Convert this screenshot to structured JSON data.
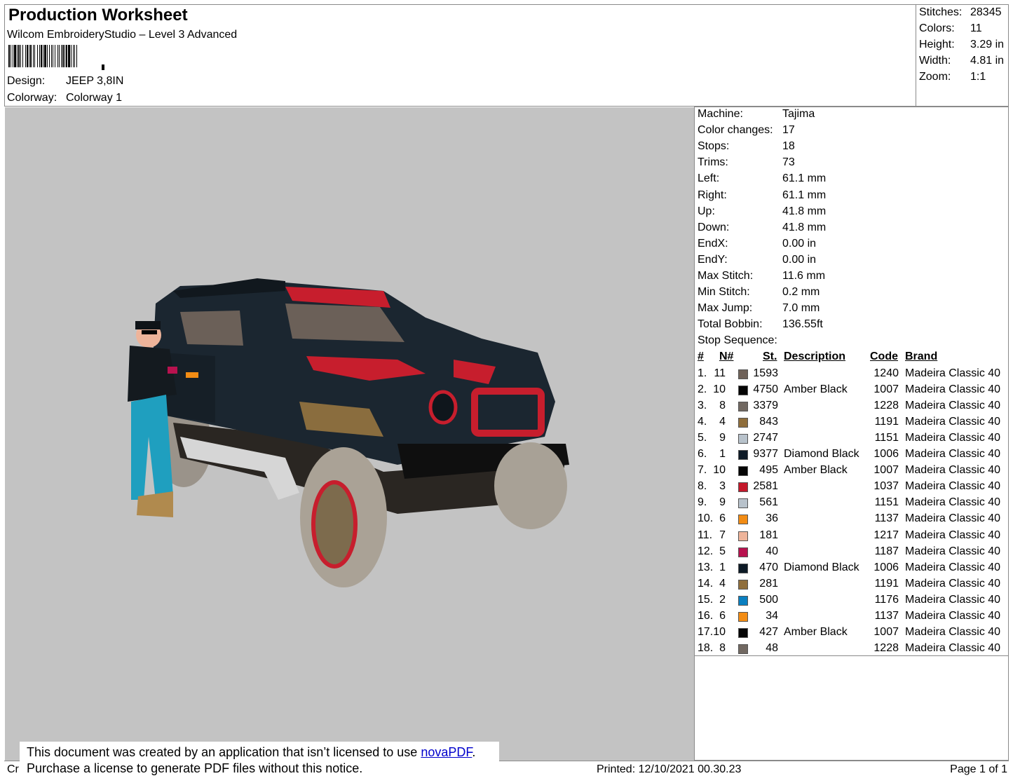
{
  "header": {
    "title": "Production Worksheet",
    "subtitle": "Wilcom EmbroideryStudio – Level 3 Advanced",
    "design_label": "Design:",
    "design_value": "JEEP 3,8IN",
    "colorway_label": "Colorway:",
    "colorway_value": "Colorway 1"
  },
  "summary": [
    {
      "label": "Stitches:",
      "value": "28345"
    },
    {
      "label": "Colors:",
      "value": "11"
    },
    {
      "label": "Height:",
      "value": "3.29 in"
    },
    {
      "label": "Width:",
      "value": "4.81 in"
    },
    {
      "label": "Zoom:",
      "value": "1:1"
    }
  ],
  "machine_info": [
    {
      "label": "Machine:",
      "value": "Tajima"
    },
    {
      "label": "Color changes:",
      "value": "17"
    },
    {
      "label": "Stops:",
      "value": "18"
    },
    {
      "label": "Trims:",
      "value": "73"
    },
    {
      "label": "Left:",
      "value": "61.1 mm"
    },
    {
      "label": "Right:",
      "value": "61.1 mm"
    },
    {
      "label": "Up:",
      "value": "41.8 mm"
    },
    {
      "label": "Down:",
      "value": "41.8 mm"
    },
    {
      "label": "EndX:",
      "value": "0.00 in"
    },
    {
      "label": "EndY:",
      "value": "0.00 in"
    },
    {
      "label": "Max Stitch:",
      "value": "11.6 mm"
    },
    {
      "label": "Min Stitch:",
      "value": "0.2 mm"
    },
    {
      "label": "Max Jump:",
      "value": "7.0 mm"
    },
    {
      "label": "Total Bobbin:",
      "value": "136.55ft"
    }
  ],
  "stop_sequence": {
    "title": "Stop Sequence:",
    "headers": {
      "num": "#",
      "needle": "N#",
      "stitches": "St.",
      "description": "Description",
      "code": "Code",
      "brand": "Brand"
    },
    "rows": [
      {
        "num": "1.",
        "needle": "11",
        "color": "#6f6259",
        "stitches": "1593",
        "description": "",
        "code": "1240",
        "brand": "Madeira Classic 40"
      },
      {
        "num": "2.",
        "needle": "10",
        "color": "#050505",
        "stitches": "4750",
        "description": "Amber Black",
        "code": "1007",
        "brand": "Madeira Classic 40"
      },
      {
        "num": "3.",
        "needle": "8",
        "color": "#716861",
        "stitches": "3379",
        "description": "",
        "code": "1228",
        "brand": "Madeira Classic 40"
      },
      {
        "num": "4.",
        "needle": "4",
        "color": "#8f6e3c",
        "stitches": "843",
        "description": "",
        "code": "1191",
        "brand": "Madeira Classic 40"
      },
      {
        "num": "5.",
        "needle": "9",
        "color": "#b8c2cb",
        "stitches": "2747",
        "description": "",
        "code": "1151",
        "brand": "Madeira Classic 40"
      },
      {
        "num": "6.",
        "needle": "1",
        "color": "#0d1a26",
        "stitches": "9377",
        "description": "Diamond Black",
        "code": "1006",
        "brand": "Madeira Classic 40"
      },
      {
        "num": "7.",
        "needle": "10",
        "color": "#050505",
        "stitches": "495",
        "description": "Amber Black",
        "code": "1007",
        "brand": "Madeira Classic 40"
      },
      {
        "num": "8.",
        "needle": "3",
        "color": "#c4182a",
        "stitches": "2581",
        "description": "",
        "code": "1037",
        "brand": "Madeira Classic 40"
      },
      {
        "num": "9.",
        "needle": "9",
        "color": "#b8c2cb",
        "stitches": "561",
        "description": "",
        "code": "1151",
        "brand": "Madeira Classic 40"
      },
      {
        "num": "10.",
        "needle": "6",
        "color": "#f28c14",
        "stitches": "36",
        "description": "",
        "code": "1137",
        "brand": "Madeira Classic 40"
      },
      {
        "num": "11.",
        "needle": "7",
        "color": "#eeb49a",
        "stitches": "181",
        "description": "",
        "code": "1217",
        "brand": "Madeira Classic 40"
      },
      {
        "num": "12.",
        "needle": "5",
        "color": "#b8124f",
        "stitches": "40",
        "description": "",
        "code": "1187",
        "brand": "Madeira Classic 40"
      },
      {
        "num": "13.",
        "needle": "1",
        "color": "#0d1a26",
        "stitches": "470",
        "description": "Diamond Black",
        "code": "1006",
        "brand": "Madeira Classic 40"
      },
      {
        "num": "14.",
        "needle": "4",
        "color": "#8f6e3c",
        "stitches": "281",
        "description": "",
        "code": "1191",
        "brand": "Madeira Classic 40"
      },
      {
        "num": "15.",
        "needle": "2",
        "color": "#0a7fc0",
        "stitches": "500",
        "description": "",
        "code": "1176",
        "brand": "Madeira Classic 40"
      },
      {
        "num": "16.",
        "needle": "6",
        "color": "#f28c14",
        "stitches": "34",
        "description": "",
        "code": "1137",
        "brand": "Madeira Classic 40"
      },
      {
        "num": "17.",
        "needle": "10",
        "color": "#050505",
        "stitches": "427",
        "description": "Amber Black",
        "code": "1007",
        "brand": "Madeira Classic 40"
      },
      {
        "num": "18.",
        "needle": "8",
        "color": "#716861",
        "stitches": "48",
        "description": "",
        "code": "1228",
        "brand": "Madeira Classic 40"
      }
    ]
  },
  "footer": {
    "left_fragment": "Cr",
    "printed": "Printed: 12/10/2021 00.30.23",
    "page": "Page 1 of 1"
  },
  "notice": {
    "line1_prefix": "This document was created by an application that isn’t licensed to use ",
    "link": "novaPDF",
    "line1_suffix": ".",
    "line2": "Purchase a license to generate PDF files without this notice."
  }
}
